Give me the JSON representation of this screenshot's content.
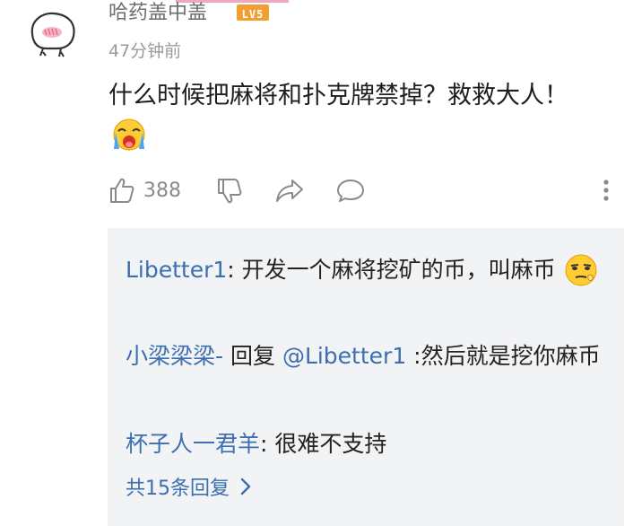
{
  "comment": {
    "username": "哈药盖中盖",
    "level": "LV5",
    "time": "47分钟前",
    "text": "什么时候把麻将和扑克牌禁掉？救救大人！",
    "emoji_icon": "crying-emoji-icon"
  },
  "actions": {
    "like_count": "388",
    "icons": [
      "thumbs-up-icon",
      "thumbs-down-icon",
      "share-icon",
      "comment-icon",
      "more-icon"
    ]
  },
  "replies": [
    {
      "user": "Libetter1",
      "sep": ": ",
      "text": "开发一个麻将挖矿的币，叫麻币",
      "emoji_icon": "smirk-emoji-icon"
    },
    {
      "user": "小梁梁梁-",
      "mid": " 回复 ",
      "mention": "@Libetter1",
      "text": " :然后就是挖你麻币"
    },
    {
      "user": "杯子人一君羊",
      "sep": ": ",
      "text": "很难不支持"
    }
  ],
  "more_replies_label": "共15条回复",
  "colors": {
    "link": "#3b6fb0",
    "panel": "#f2f3f5",
    "level": "#f0a030"
  }
}
